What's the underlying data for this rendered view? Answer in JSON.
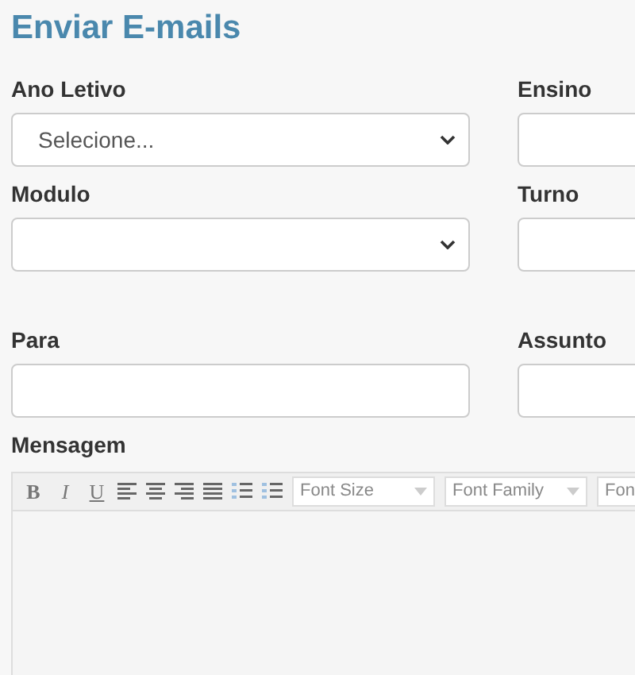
{
  "title": "Enviar E-mails",
  "field_rows": [
    [
      {
        "label": "Ano Letivo",
        "kind": "select",
        "value": "Selecione..."
      },
      {
        "label": "Ensino",
        "kind": "select"
      }
    ],
    [
      {
        "label": "Modulo",
        "kind": "select"
      },
      {
        "label": "Turno",
        "kind": "select"
      }
    ],
    [
      {
        "label": "Para",
        "kind": "text"
      },
      {
        "label": "Assunto",
        "kind": "text"
      }
    ]
  ],
  "editor": {
    "label": "Mensagem",
    "toolbar": [
      {
        "kind": "bold",
        "text": "B"
      },
      {
        "kind": "italic",
        "text": "I"
      },
      {
        "kind": "underline",
        "text": "U"
      },
      {
        "kind": "align-left"
      },
      {
        "kind": "align-center"
      },
      {
        "kind": "align-right"
      },
      {
        "kind": "justify"
      },
      {
        "kind": "numbered-list"
      },
      {
        "kind": "bullet-list"
      },
      {
        "kind": "dropdown",
        "text": "Font Size"
      },
      {
        "kind": "dropdown",
        "text": "Font Family"
      },
      {
        "kind": "dropdown",
        "text": "Fon"
      }
    ]
  }
}
